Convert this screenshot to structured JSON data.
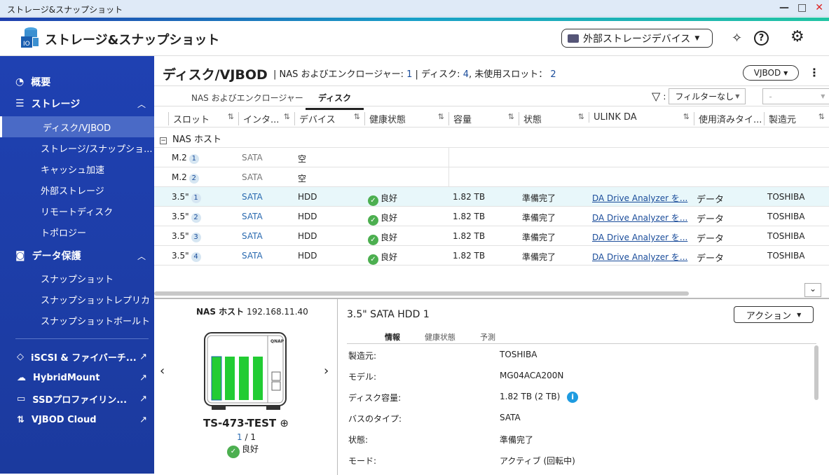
{
  "window": {
    "title": "ストレージ&スナップショット",
    "minimize": "—",
    "maximize": "□",
    "close": "✕"
  },
  "header": {
    "app_title": "ストレージ&スナップショット",
    "external_storage": "外部ストレージデバイス"
  },
  "sidebar": {
    "overview": "概要",
    "storage": "ストレージ",
    "storage_items": [
      "ディスク/VJBOD",
      "ストレージ/スナップショ...",
      "キャッシュ加速",
      "外部ストレージ",
      "リモートディスク",
      "トポロジー"
    ],
    "data_protection": "データ保護",
    "dp_items": [
      "スナップショット",
      "スナップショットレプリカ",
      "スナップショットボールト"
    ],
    "external_apps": [
      "iSCSI & ファイバーチ...",
      "HybridMount",
      "SSDプロファイリン...",
      "VJBOD Cloud"
    ]
  },
  "page": {
    "title": "ディスク/VJBOD",
    "nas_label": "NAS およびエンクロージャー:",
    "nas_count": "1",
    "disk_label": "ディスク:",
    "disk_count": "4",
    "unused_label": ", 未使用スロット：",
    "unused_count": "2",
    "vjbod_button": "VJBOD"
  },
  "tabs": [
    "NAS およびエンクロージャー",
    "ディスク"
  ],
  "filter": {
    "value": "フィルターなし",
    "second": "-"
  },
  "columns": [
    "スロット",
    "インタ...",
    "デバイス",
    "健康状態",
    "容量",
    "状態",
    "ULINK DA",
    "使用済みタイ...",
    "製造元"
  ],
  "group": "NAS ホスト",
  "rows": [
    {
      "slot": "M.2",
      "num": "1",
      "iface": "SATA",
      "device": "空"
    },
    {
      "slot": "M.2",
      "num": "2",
      "iface": "SATA",
      "device": "空"
    },
    {
      "slot": "3.5\"",
      "num": "1",
      "iface": "SATA",
      "device": "HDD",
      "health": "良好",
      "capacity": "1.82 TB",
      "status": "準備完了",
      "ulink": "DA Drive Analyzer を...",
      "type": "データ",
      "vendor": "TOSHIBA"
    },
    {
      "slot": "3.5\"",
      "num": "2",
      "iface": "SATA",
      "device": "HDD",
      "health": "良好",
      "capacity": "1.82 TB",
      "status": "準備完了",
      "ulink": "DA Drive Analyzer を...",
      "type": "データ",
      "vendor": "TOSHIBA"
    },
    {
      "slot": "3.5\"",
      "num": "3",
      "iface": "SATA",
      "device": "HDD",
      "health": "良好",
      "capacity": "1.82 TB",
      "status": "準備完了",
      "ulink": "DA Drive Analyzer を...",
      "type": "データ",
      "vendor": "TOSHIBA"
    },
    {
      "slot": "3.5\"",
      "num": "4",
      "iface": "SATA",
      "device": "HDD",
      "health": "良好",
      "capacity": "1.82 TB",
      "status": "準備完了",
      "ulink": "DA Drive Analyzer を...",
      "type": "データ",
      "vendor": "TOSHIBA"
    }
  ],
  "nas": {
    "label": "NAS ホスト",
    "ip": "192.168.11.40",
    "brand": "QNAP",
    "name": "TS-473-TEST",
    "page_current": "1",
    "page_total": "/ 1",
    "status": "良好"
  },
  "detail": {
    "title": "3.5\" SATA HDD 1",
    "action": "アクション",
    "tabs": [
      "情報",
      "健康状態",
      "予測"
    ],
    "info": [
      {
        "k": "製造元:",
        "v": "TOSHIBA"
      },
      {
        "k": "モデル:",
        "v": "MG04ACA200N"
      },
      {
        "k": "ディスク容量:",
        "v": "1.82 TB (2 TB)"
      },
      {
        "k": "バスのタイプ:",
        "v": "SATA"
      },
      {
        "k": "状態:",
        "v": "準備完了"
      },
      {
        "k": "モード:",
        "v": "アクティブ (回転中)"
      }
    ]
  },
  "colors": {
    "sidebar": "#1f41b2",
    "accent": "#1a4c9a",
    "ok": "#4caf50",
    "selected_row": "#e8f7fa"
  }
}
